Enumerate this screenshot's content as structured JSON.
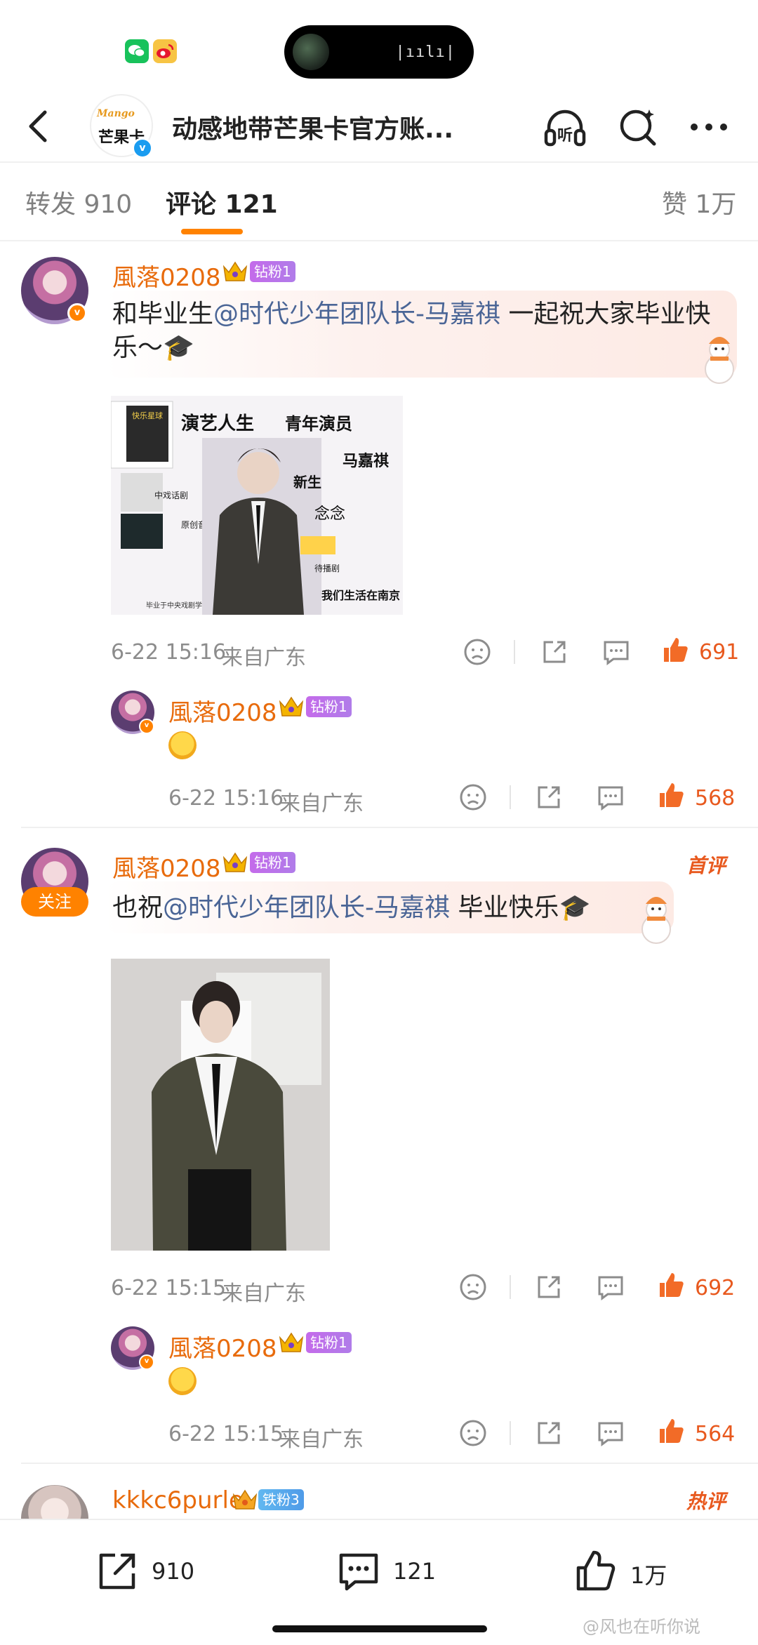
{
  "status_bar": {
    "apps": [
      "wechat-icon",
      "weibo-icon"
    ],
    "island_wave": "|ıılı|"
  },
  "header": {
    "title": "动感地带芒果卡官方账...",
    "avatar_logo_top": "Mango",
    "avatar_logo_main": "芒果卡",
    "verified_mark": "v",
    "icons": [
      "back-icon",
      "listen-icon",
      "search-icon",
      "more-icon"
    ],
    "listen_label": "听"
  },
  "tabs": {
    "repost": "转发 910",
    "comments": "评论 121",
    "likes": "赞 1万"
  },
  "comments": [
    {
      "user": "風落0208",
      "fan_badge": "钻粉1",
      "text_prefix": "和毕业生",
      "mention": "@时代少年团队长-马嘉祺",
      "text_suffix": " 一起祝大家毕业快乐～🎓",
      "time": "6-22 15:16",
      "location": "来自广东",
      "likes": "691",
      "reply": {
        "user": "風落0208",
        "fan_badge": "钻粉1",
        "emoji": "😝",
        "time": "6-22 15:16",
        "location": "来自广东",
        "likes": "568"
      }
    },
    {
      "user": "風落0208",
      "fan_badge": "钻粉1",
      "follow_label": "关注",
      "tag": "首评",
      "text_prefix": "也祝",
      "mention": "@时代少年团队长-马嘉祺",
      "text_suffix": " 毕业快乐🎓",
      "time": "6-22 15:15",
      "location": "来自广东",
      "likes": "692",
      "reply": {
        "user": "風落0208",
        "fan_badge": "钻粉1",
        "emoji": "🥺",
        "time": "6-22 15:15",
        "location": "来自广东",
        "likes": "564"
      }
    },
    {
      "user": "kkkc6purle",
      "fan_badge": "铁粉3",
      "tag": "热评"
    }
  ],
  "image1_texts": {
    "t1": "快乐星球",
    "t2": "演艺人生",
    "t3": "青年演员",
    "t4": "马嘉祺",
    "t5": "中戏话剧",
    "t6": "新生",
    "t7": "念念",
    "t8": "原创音乐剧",
    "t9": "待播剧",
    "t10": "毕业于中央戏剧学院",
    "t11": "我们生活在南京"
  },
  "bottom_bar": {
    "repost": "910",
    "comment": "121",
    "like": "1万"
  },
  "watermark": "@风也在听你说",
  "colors": {
    "accent": "#ff8200",
    "username": "#e86b0c",
    "mention": "#4a6596",
    "like": "#e8591e",
    "tag": "#e8591e"
  }
}
